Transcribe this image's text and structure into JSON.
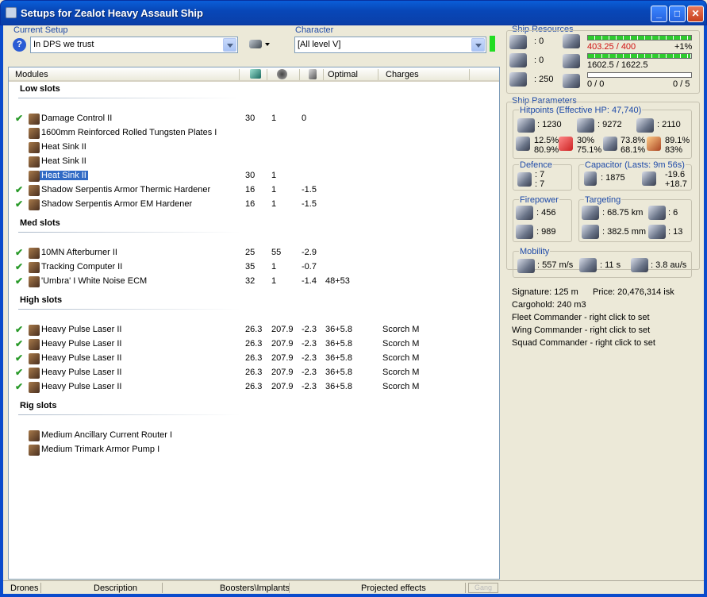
{
  "window": {
    "title": "Setups for Zealot Heavy Assault Ship",
    "min": "_",
    "max": "□",
    "close": "✕"
  },
  "setup": {
    "label": "Current Setup",
    "value": "In DPS we trust"
  },
  "character": {
    "label": "Character",
    "value": "[All level V]"
  },
  "columns": {
    "modules": "Modules",
    "optimal": "Optimal",
    "charges": "Charges"
  },
  "sections": {
    "low": "Low slots",
    "med": "Med slots",
    "high": "High slots",
    "rig": "Rig slots"
  },
  "low": [
    {
      "c": "✔",
      "name": "Damage Control II",
      "a": "30",
      "b": "1",
      "d": "0",
      "o": "",
      "ch": ""
    },
    {
      "c": "",
      "name": "1600mm Reinforced Rolled Tungsten Plates I",
      "a": "",
      "b": "",
      "d": "",
      "o": "",
      "ch": ""
    },
    {
      "c": "",
      "name": "Heat Sink II",
      "a": "",
      "b": "",
      "d": "",
      "o": "",
      "ch": ""
    },
    {
      "c": "",
      "name": "Heat Sink II",
      "a": "",
      "b": "",
      "d": "",
      "o": "",
      "ch": ""
    },
    {
      "c": "",
      "name": "Heat Sink II",
      "a": "30",
      "b": "1",
      "d": "",
      "o": "",
      "ch": ""
    },
    {
      "c": "✔",
      "name": "Shadow Serpentis Armor Thermic Hardener",
      "a": "16",
      "b": "1",
      "d": "-1.5",
      "o": "",
      "ch": ""
    },
    {
      "c": "✔",
      "name": "Shadow Serpentis Armor EM Hardener",
      "a": "16",
      "b": "1",
      "d": "-1.5",
      "o": "",
      "ch": ""
    }
  ],
  "med": [
    {
      "c": "✔",
      "name": "10MN Afterburner II",
      "a": "25",
      "b": "55",
      "d": "-2.9",
      "o": "",
      "ch": ""
    },
    {
      "c": "✔",
      "name": "Tracking Computer II",
      "a": "35",
      "b": "1",
      "d": "-0.7",
      "o": "",
      "ch": ""
    },
    {
      "c": "✔",
      "name": "'Umbra' I White Noise ECM",
      "a": "32",
      "b": "1",
      "d": "-1.4",
      "o": "48+53",
      "ch": ""
    }
  ],
  "high": [
    {
      "c": "✔",
      "name": "Heavy Pulse Laser II",
      "a": "26.3",
      "b": "207.9",
      "d": "-2.3",
      "o": "36+5.8",
      "ch": "Scorch M"
    },
    {
      "c": "✔",
      "name": "Heavy Pulse Laser II",
      "a": "26.3",
      "b": "207.9",
      "d": "-2.3",
      "o": "36+5.8",
      "ch": "Scorch M"
    },
    {
      "c": "✔",
      "name": "Heavy Pulse Laser II",
      "a": "26.3",
      "b": "207.9",
      "d": "-2.3",
      "o": "36+5.8",
      "ch": "Scorch M"
    },
    {
      "c": "✔",
      "name": "Heavy Pulse Laser II",
      "a": "26.3",
      "b": "207.9",
      "d": "-2.3",
      "o": "36+5.8",
      "ch": "Scorch M"
    },
    {
      "c": "✔",
      "name": "Heavy Pulse Laser II",
      "a": "26.3",
      "b": "207.9",
      "d": "-2.3",
      "o": "36+5.8",
      "ch": "Scorch M"
    }
  ],
  "rig": [
    {
      "c": "",
      "name": "Medium Ancillary Current Router I",
      "a": "",
      "b": "",
      "d": "",
      "o": "",
      "ch": ""
    },
    {
      "c": "",
      "name": "Medium Trimark Armor Pump I",
      "a": "",
      "b": "",
      "d": "",
      "o": "",
      "ch": ""
    }
  ],
  "resources": {
    "title": "Ship Resources",
    "turrets": ": 0",
    "launchers": ": 0",
    "calibration": ": 250",
    "cpu": "403.25 / 400",
    "cpu_pct": "+1%",
    "power": "1602.5 / 1622.5",
    "drone_bw": "0 / 0",
    "drones": "0 / 5",
    "cpu_fill": 1,
    "power_fill": 0.99,
    "drone_fill": 0
  },
  "params": {
    "title": "Ship Parameters",
    "hp": "Hitpoints (Effective HP: 47,740)",
    "shield": ": 1230",
    "armor": ": 9272",
    "structure": ": 2110",
    "res": [
      [
        "12.5%",
        "80.9%"
      ],
      [
        "30%",
        "75.1%"
      ],
      [
        "73.8%",
        "68.1%"
      ],
      [
        "89.1%",
        "83%"
      ]
    ],
    "defence": "Defence",
    "def1": ": 7",
    "def2": ": 7",
    "cap": "Capacitor (Lasts: 9m 56s)",
    "cap_val": ": 1875",
    "cap_d1": "-19.6",
    "cap_d2": "+18.7",
    "fire": "Firepower",
    "dps": ": 456",
    "volley": ": 989",
    "target": "Targeting",
    "range": ": 68.75 km",
    "targets": ": 6",
    "scan": ": 382.5 mm",
    "sens": ": 13",
    "mob": "Mobility",
    "speed": ": 557 m/s",
    "align": ": 11 s",
    "warp": ": 3.8 au/s"
  },
  "info": {
    "sig": "Signature: 125 m",
    "price": "Price: 20,476,314 isk",
    "cargo": "Cargohold: 240 m3",
    "fleet": "Fleet Commander - right click to set",
    "wing": "Wing Commander - right click to set",
    "squad": "Squad Commander - right click to set"
  },
  "status": {
    "drones": "Drones",
    "desc": "Description",
    "boosters": "Boosters\\Implants",
    "proj": "Projected effects",
    "gang": "Gang"
  }
}
